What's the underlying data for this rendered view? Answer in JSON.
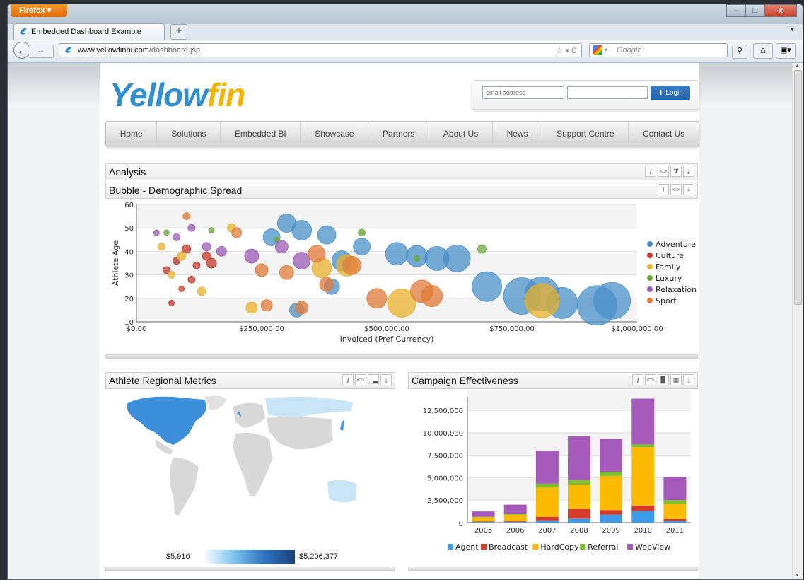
{
  "browser": {
    "app_button": "Firefox",
    "tab_title": "Embedded Dashboard Example",
    "url_domain": "www.yellowfinbi.com",
    "url_path": "/dashboard.jsp",
    "search_placeholder": "Google"
  },
  "site": {
    "logo_y": "Y",
    "logo_ellow": "ellow",
    "logo_fin": "fin",
    "email_placeholder": "email address",
    "login_label": "Login",
    "nav": [
      "Home",
      "Solutions",
      "Embedded BI",
      "Showcase",
      "Partners",
      "About Us",
      "News",
      "Support Centre",
      "Contact Us"
    ]
  },
  "panels": {
    "analysis_title": "Analysis",
    "bubble_title": "Bubble - Demographic Spread",
    "map_title": "Athlete Regional Metrics",
    "campaign_title": "Campaign Effectiveness",
    "map_min": "$5,910",
    "map_max": "$5,206,377"
  },
  "colors": {
    "adventure": "#4a90c8",
    "culture": "#c0392b",
    "family": "#e8b22c",
    "luxury": "#6aa83c",
    "relaxation": "#9b59b6",
    "sport": "#e07b39",
    "agent": "#3d9be9",
    "broadcast": "#d63a2a",
    "hardcopy": "#fbbb00",
    "referral": "#7ac02e",
    "webview": "#a65bbb"
  },
  "chart_data": [
    {
      "type": "scatter",
      "title": "Bubble - Demographic Spread",
      "xlabel": "Invoiced (Pref Currency)",
      "ylabel": "Athlete Age",
      "xlim": [
        0,
        1000000
      ],
      "ylim": [
        10,
        60
      ],
      "x_ticks": [
        "$0.00",
        "$250,000.00",
        "$500,000.00",
        "$750,000.00",
        "$1,000,000.00"
      ],
      "y_ticks": [
        "10",
        "20",
        "30",
        "40",
        "50",
        "60"
      ],
      "legend": "right",
      "series": [
        {
          "name": "Adventure",
          "points": [
            [
              270000,
              46,
              12
            ],
            [
              300000,
              52,
              13
            ],
            [
              330000,
              49,
              14
            ],
            [
              380000,
              47,
              13
            ],
            [
              410000,
              36,
              14
            ],
            [
              450000,
              42,
              12
            ],
            [
              520000,
              39,
              16
            ],
            [
              560000,
              38,
              15
            ],
            [
              600000,
              37,
              17
            ],
            [
              640000,
              37,
              19
            ],
            [
              700000,
              25,
              21
            ],
            [
              770000,
              21,
              26
            ],
            [
              810000,
              22,
              24
            ],
            [
              850000,
              18,
              22
            ],
            [
              920000,
              17,
              28
            ],
            [
              950000,
              19,
              26
            ],
            [
              320000,
              15,
              10
            ],
            [
              390000,
              25,
              11
            ]
          ]
        },
        {
          "name": "Culture",
          "points": [
            [
              60000,
              32,
              5
            ],
            [
              80000,
              36,
              5
            ],
            [
              100000,
              41,
              6
            ],
            [
              120000,
              34,
              5
            ],
            [
              140000,
              38,
              6
            ],
            [
              90000,
              24,
              4
            ],
            [
              150000,
              35,
              7
            ],
            [
              70000,
              18,
              4
            ],
            [
              110000,
              28,
              5
            ]
          ]
        },
        {
          "name": "Family",
          "points": [
            [
              50000,
              42,
              5
            ],
            [
              70000,
              30,
              5
            ],
            [
              90000,
              38,
              6
            ],
            [
              130000,
              23,
              6
            ],
            [
              190000,
              50,
              6
            ],
            [
              230000,
              16,
              8
            ],
            [
              370000,
              33,
              14
            ],
            [
              420000,
              34,
              15
            ],
            [
              530000,
              18,
              20
            ],
            [
              810000,
              19,
              24
            ]
          ]
        },
        {
          "name": "Luxury",
          "points": [
            [
              60000,
              48,
              4
            ],
            [
              150000,
              49,
              4
            ],
            [
              280000,
              45,
              4
            ],
            [
              450000,
              48,
              5
            ],
            [
              560000,
              37,
              4
            ],
            [
              690000,
              41,
              6
            ]
          ]
        },
        {
          "name": "Relaxation",
          "points": [
            [
              40000,
              48,
              4
            ],
            [
              80000,
              46,
              5
            ],
            [
              110000,
              50,
              5
            ],
            [
              140000,
              42,
              6
            ],
            [
              170000,
              40,
              7
            ],
            [
              230000,
              38,
              10
            ],
            [
              330000,
              36,
              12
            ],
            [
              290000,
              42,
              9
            ]
          ]
        },
        {
          "name": "Sport",
          "points": [
            [
              100000,
              55,
              5
            ],
            [
              200000,
              48,
              7
            ],
            [
              250000,
              32,
              9
            ],
            [
              300000,
              31,
              10
            ],
            [
              360000,
              39,
              12
            ],
            [
              430000,
              34,
              13
            ],
            [
              480000,
              20,
              14
            ],
            [
              570000,
              23,
              16
            ],
            [
              590000,
              21,
              15
            ],
            [
              330000,
              16,
              9
            ],
            [
              260000,
              17,
              8
            ],
            [
              380000,
              26,
              10
            ]
          ]
        }
      ]
    },
    {
      "type": "bar",
      "title": "Campaign Effectiveness",
      "categories": [
        "2005",
        "2006",
        "2007",
        "2008",
        "2009",
        "2010",
        "2011"
      ],
      "ylim": [
        0,
        14000000
      ],
      "y_ticks": [
        "0",
        "2,500,000",
        "5,000,000",
        "7,500,000",
        "10,000,000",
        "12,500,000"
      ],
      "legend": "bottom",
      "stacked": true,
      "series": [
        {
          "name": "Agent",
          "values": [
            100000,
            100000,
            250000,
            450000,
            900000,
            1300000,
            200000
          ]
        },
        {
          "name": "Broadcast",
          "values": [
            50000,
            100000,
            400000,
            1100000,
            500000,
            600000,
            200000
          ]
        },
        {
          "name": "HardCopy",
          "values": [
            450000,
            700000,
            3300000,
            2700000,
            3800000,
            6500000,
            1700000
          ]
        },
        {
          "name": "Referral",
          "values": [
            50000,
            100000,
            400000,
            500000,
            450000,
            300000,
            400000
          ]
        },
        {
          "name": "WebView",
          "values": [
            600000,
            1000000,
            3650000,
            4850000,
            3700000,
            5100000,
            2600000
          ]
        }
      ]
    }
  ]
}
